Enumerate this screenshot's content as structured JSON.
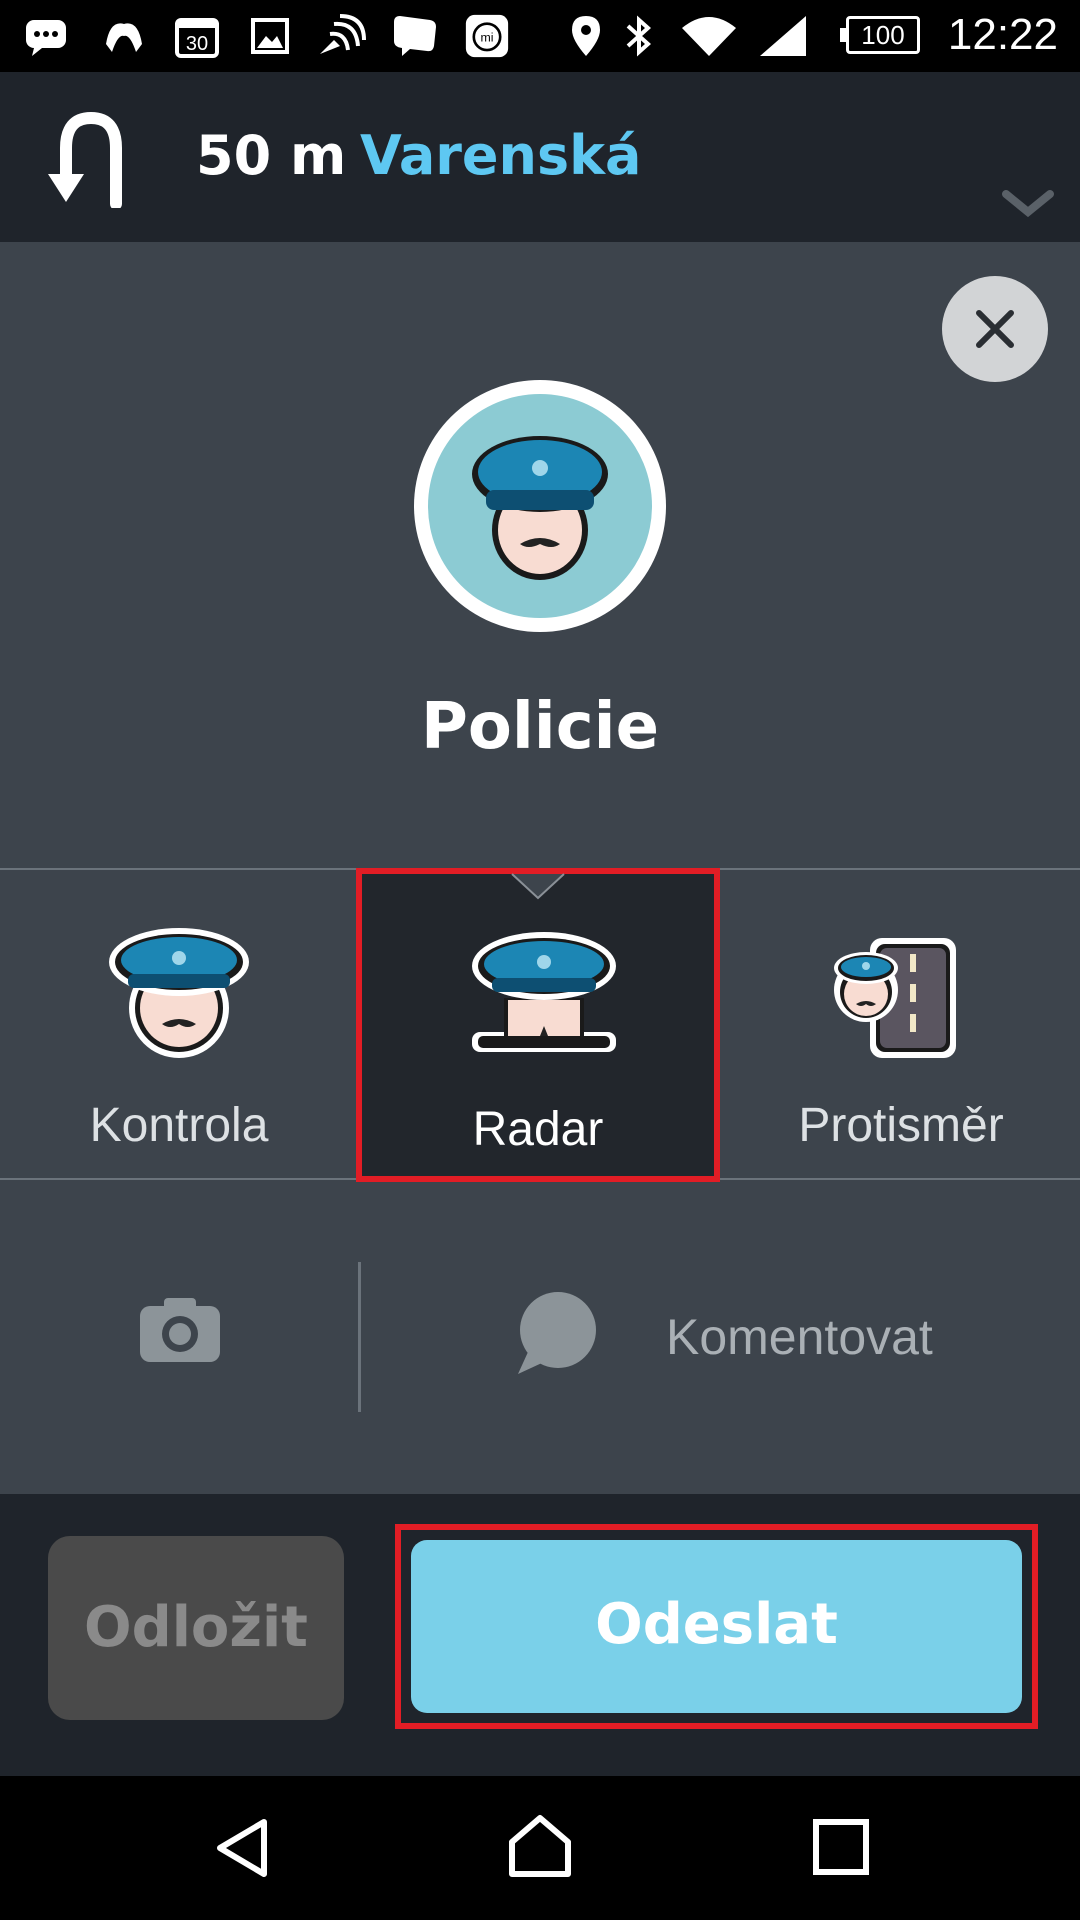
{
  "status_bar": {
    "time": "12:22",
    "battery": "100",
    "calendar_day": "30",
    "mi_label": "mi",
    "icons": [
      "chat-notification-icon",
      "app-icon",
      "calendar-icon",
      "image-icon",
      "cast-icon",
      "messages-icon",
      "mi-icon",
      "location-icon",
      "bluetooth-icon",
      "wifi-icon",
      "signal-icon",
      "battery-icon"
    ]
  },
  "navigation": {
    "turn_icon": "u-turn-icon",
    "distance": "50 m",
    "street": "Varenská"
  },
  "report": {
    "title": "Policie",
    "options": [
      {
        "label": "Kontrola",
        "icon": "police-officer-icon",
        "selected": false
      },
      {
        "label": "Radar",
        "icon": "police-radar-icon",
        "selected": true
      },
      {
        "label": "Protisměr",
        "icon": "police-opposite-lane-icon",
        "selected": false
      }
    ],
    "comment_label": "Komentovat"
  },
  "buttons": {
    "later": "Odložit",
    "send": "Odeslat"
  },
  "colors": {
    "accent": "#5ec8f2",
    "send_button": "#7ad0e9",
    "highlight": "#e21d25",
    "panel_bg": "#3d444c",
    "nav_bg": "#1f242b"
  }
}
